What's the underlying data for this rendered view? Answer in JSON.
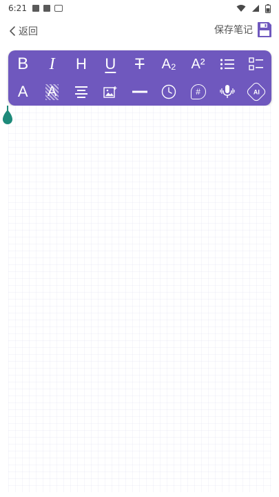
{
  "status_bar": {
    "time": "6:21"
  },
  "header": {
    "back_label": "返回",
    "save_label": "保存笔记"
  },
  "toolbar": {
    "accent_color": "#6f58be",
    "row1": [
      {
        "name": "bold-icon",
        "label": "B"
      },
      {
        "name": "italic-icon",
        "label": "I"
      },
      {
        "name": "heading-icon",
        "label": "H"
      },
      {
        "name": "underline-icon",
        "label": "U"
      },
      {
        "name": "strikethrough-icon",
        "label": "T"
      },
      {
        "name": "subscript-icon",
        "label": "A₂"
      },
      {
        "name": "superscript-icon",
        "label": "A²"
      },
      {
        "name": "bullet-list-icon"
      },
      {
        "name": "checklist-icon"
      }
    ],
    "row2": [
      {
        "name": "text-color-icon",
        "label": "A"
      },
      {
        "name": "highlight-icon",
        "label": "A"
      },
      {
        "name": "align-icon"
      },
      {
        "name": "insert-image-icon"
      },
      {
        "name": "divider-line-icon"
      },
      {
        "name": "clock-icon"
      },
      {
        "name": "hashtag-icon",
        "label": "#"
      },
      {
        "name": "microphone-icon"
      },
      {
        "name": "ai-icon",
        "label": "AI"
      }
    ]
  },
  "cursor_color": "#1e8a7a"
}
